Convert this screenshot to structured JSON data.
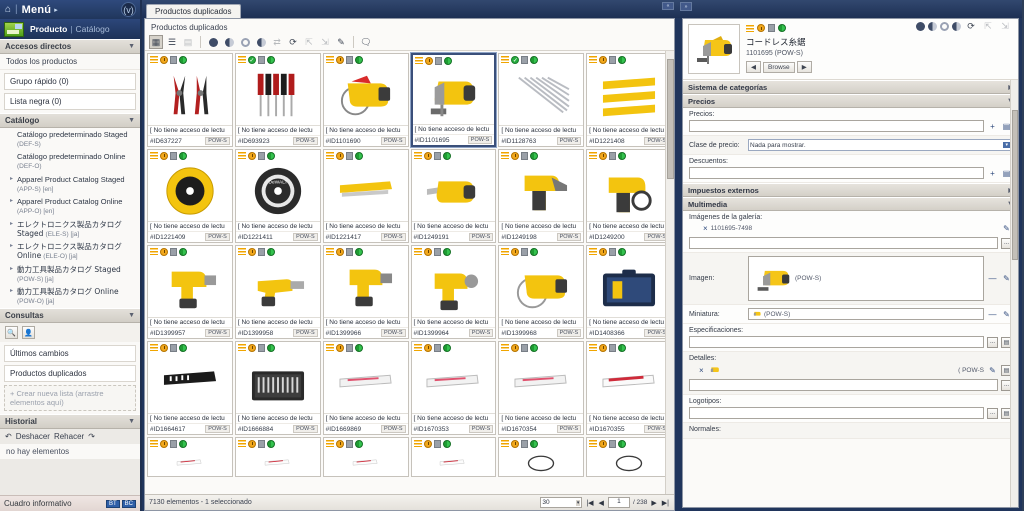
{
  "sidebar": {
    "home_icon": "home-icon",
    "menu_label": "Menú",
    "menu_arrow": "▸",
    "logo_text": "(v)",
    "collapse_label": "«",
    "breadcrumb": {
      "active": "Producto",
      "divider": "|",
      "inactive": "Catálogo"
    },
    "sections": {
      "shortcuts": {
        "title": "Accesos directos",
        "twisty": "▼",
        "all_products": "Todos los productos",
        "quick_group": "Grupo rápido (0)",
        "blacklist": "Lista negra (0)"
      },
      "catalog": {
        "title": "Catálogo",
        "twisty": "▼",
        "items": [
          {
            "name": "Catálogo predeterminado Staged",
            "code": "(DEF-S)",
            "expandable": false,
            "extra": ""
          },
          {
            "name": "Catálogo predeterminado Online",
            "code": "(DEF-O)",
            "expandable": false,
            "extra": ""
          },
          {
            "name": "Apparel Product Catalog Staged",
            "code": "(APP-S)",
            "expandable": true,
            "extra": "[en]"
          },
          {
            "name": "Apparel Product Catalog Online",
            "code": "(APP-O)",
            "expandable": true,
            "extra": "[en]"
          },
          {
            "name": "エレクトロニクス製品カタログ Staged",
            "code": "(ELE-S)",
            "expandable": true,
            "extra": "[ja]"
          },
          {
            "name": "エレクトロニクス製品カタログ Online",
            "code": "(ELE-O)",
            "expandable": true,
            "extra": "[ja]"
          },
          {
            "name": "動力工具製品カタログ Staged",
            "code": "(POW-S)",
            "expandable": true,
            "extra": "[ja]"
          },
          {
            "name": "動力工具製品カタログ Online",
            "code": "(POW-O)",
            "expandable": true,
            "extra": "[ja]"
          }
        ]
      },
      "queries": {
        "title": "Consultas",
        "twisty": "▼",
        "tool_search": "search-icon",
        "tool_user": "user-search-icon",
        "items": [
          "Últimos cambios",
          "Productos duplicados"
        ],
        "create_new": "+ Crear nueva lista (arrastre elementos aquí)"
      },
      "history": {
        "title": "Historial",
        "twisty": "▼",
        "undo": "Deshacer",
        "redo": "Rehacer",
        "empty": "no hay elementos"
      }
    },
    "footer": {
      "label": "Cuadro informativo",
      "badge1": "BT",
      "badge2": "BC"
    }
  },
  "center": {
    "tab_label": "Productos duplicados",
    "collapse_label": "«",
    "panel_title": "Productos duplicados",
    "toolbar": {
      "grid_view": "grid-view-icon",
      "list_view": "list-view-icon",
      "columns": "columns-icon",
      "status_all": "status-all-icon",
      "status_half": "status-half-icon",
      "status_empty": "status-empty-icon",
      "status_mixed": "status-mixed-icon",
      "compare": "compare-icon",
      "sync": "sync-icon",
      "approve": "approve-icon",
      "reject": "reject-icon",
      "edit": "pencil-icon",
      "comment": "comment-icon"
    },
    "tile_noaccess": "[ No tiene acceso de lectu",
    "catalog_tag": "POW-S",
    "products": [
      {
        "id": "#ID637227",
        "image": "pliers",
        "status": "clock",
        "selected": false
      },
      {
        "id": "#ID693923",
        "image": "screwdriver-set",
        "status": "check",
        "selected": false
      },
      {
        "id": "#ID1101690",
        "image": "circular-saw",
        "status": "clock",
        "selected": false
      },
      {
        "id": "#ID1101695",
        "image": "jigsaw",
        "status": "clock",
        "selected": true
      },
      {
        "id": "#ID1128763",
        "image": "nails",
        "status": "check",
        "selected": false
      },
      {
        "id": "#ID1221408",
        "image": "saw-blades",
        "status": "clock",
        "selected": false
      },
      {
        "id": "#ID1221409",
        "image": "saw-blade-round",
        "status": "clock",
        "selected": false
      },
      {
        "id": "#ID1221411",
        "image": "diamond-blade",
        "status": "clock",
        "selected": false
      },
      {
        "id": "#ID1221417",
        "image": "blade-strip",
        "status": "clock",
        "selected": false
      },
      {
        "id": "#ID1249191",
        "image": "reciprocating-saw",
        "status": "clock",
        "selected": false
      },
      {
        "id": "#ID1249198",
        "image": "nailer",
        "status": "clock",
        "selected": false
      },
      {
        "id": "#ID1249200",
        "image": "framing-nailer",
        "status": "clock",
        "selected": false
      },
      {
        "id": "#ID1399957",
        "image": "drill-yellow",
        "status": "clock",
        "selected": false
      },
      {
        "id": "#ID1399958",
        "image": "screwdriver-cordless",
        "status": "clock",
        "selected": false
      },
      {
        "id": "#ID1399966",
        "image": "impact-driver",
        "status": "clock",
        "selected": false
      },
      {
        "id": "#ID1399964",
        "image": "drill-driver",
        "status": "clock",
        "selected": false
      },
      {
        "id": "#ID1399968",
        "image": "circular-saw-2",
        "status": "clock",
        "selected": false
      },
      {
        "id": "#ID1408366",
        "image": "tool-case",
        "status": "clock",
        "selected": false
      },
      {
        "id": "#ID1664617",
        "image": "blade-black",
        "status": "clock",
        "selected": false
      },
      {
        "id": "#ID1666884",
        "image": "bit-set-case",
        "status": "clock",
        "selected": false
      },
      {
        "id": "#ID1669869",
        "image": "blade-pink",
        "status": "clock",
        "selected": false
      },
      {
        "id": "#ID1670353",
        "image": "blade-pink-2",
        "status": "clock",
        "selected": false
      },
      {
        "id": "#ID1670354",
        "image": "blade-pink-3",
        "status": "clock",
        "selected": false
      },
      {
        "id": "#ID1670355",
        "image": "blade-red",
        "status": "clock",
        "selected": false
      }
    ],
    "partial_row": [
      {
        "image": "recip-blade-1",
        "status": "clock"
      },
      {
        "image": "recip-blade-2",
        "status": "clock"
      },
      {
        "image": "recip-blade-3",
        "status": "clock"
      },
      {
        "image": "recip-blade-4",
        "status": "clock"
      },
      {
        "image": "band-loop-1",
        "status": "clock"
      },
      {
        "image": "band-loop-2",
        "status": "clock"
      }
    ],
    "status": {
      "count_text": "7130 elementos - 1 seleccionado",
      "page_size": "30",
      "first": "|◀",
      "prev": "◀",
      "page": "1",
      "total": "/ 238",
      "next": "▶",
      "last": "▶|"
    }
  },
  "right": {
    "expand_label": "»",
    "product": {
      "title": "コードレス糸鋸",
      "code": "1101695 (POW-S)",
      "browse_prev": "◀",
      "browse_label": "Browse",
      "browse_next": "▶"
    },
    "sections": [
      {
        "name": "Sistema de categorías",
        "twisty": "▶",
        "expanded": false
      },
      {
        "name": "Precios",
        "twisty": "▼",
        "expanded": true
      },
      {
        "name": "Impuestos externos",
        "twisty": "▶",
        "expanded": false
      },
      {
        "name": "Multimedia",
        "twisty": "▼",
        "expanded": true
      }
    ],
    "fields": {
      "precios": {
        "label": "Precios:",
        "value": ""
      },
      "clase_precio": {
        "label": "Clase de precio:",
        "value": "Nada para mostrar.",
        "caret": "▾"
      },
      "descuentos": {
        "label": "Descuentos:",
        "value": ""
      },
      "galeria": {
        "label": "Imágenes de la galería:",
        "item": "1101695-7498",
        "value": ""
      },
      "imagen": {
        "label": "Imagen:",
        "tag": "(POW-S)"
      },
      "miniatura": {
        "label": "Miniatura:",
        "tag": "(POW-S)"
      },
      "especificaciones": {
        "label": "Especificaciones:",
        "value": ""
      },
      "detalles": {
        "label": "Detalles:",
        "tag": "( POW-S",
        "value": ""
      },
      "logotipos": {
        "label": "Logotipos:",
        "value": ""
      },
      "normales": {
        "label": "Normales:",
        "value": ""
      }
    },
    "buttons": {
      "add": "+",
      "browse_dots": "...",
      "edit": "✎",
      "remove": "—",
      "clear": "×"
    }
  }
}
